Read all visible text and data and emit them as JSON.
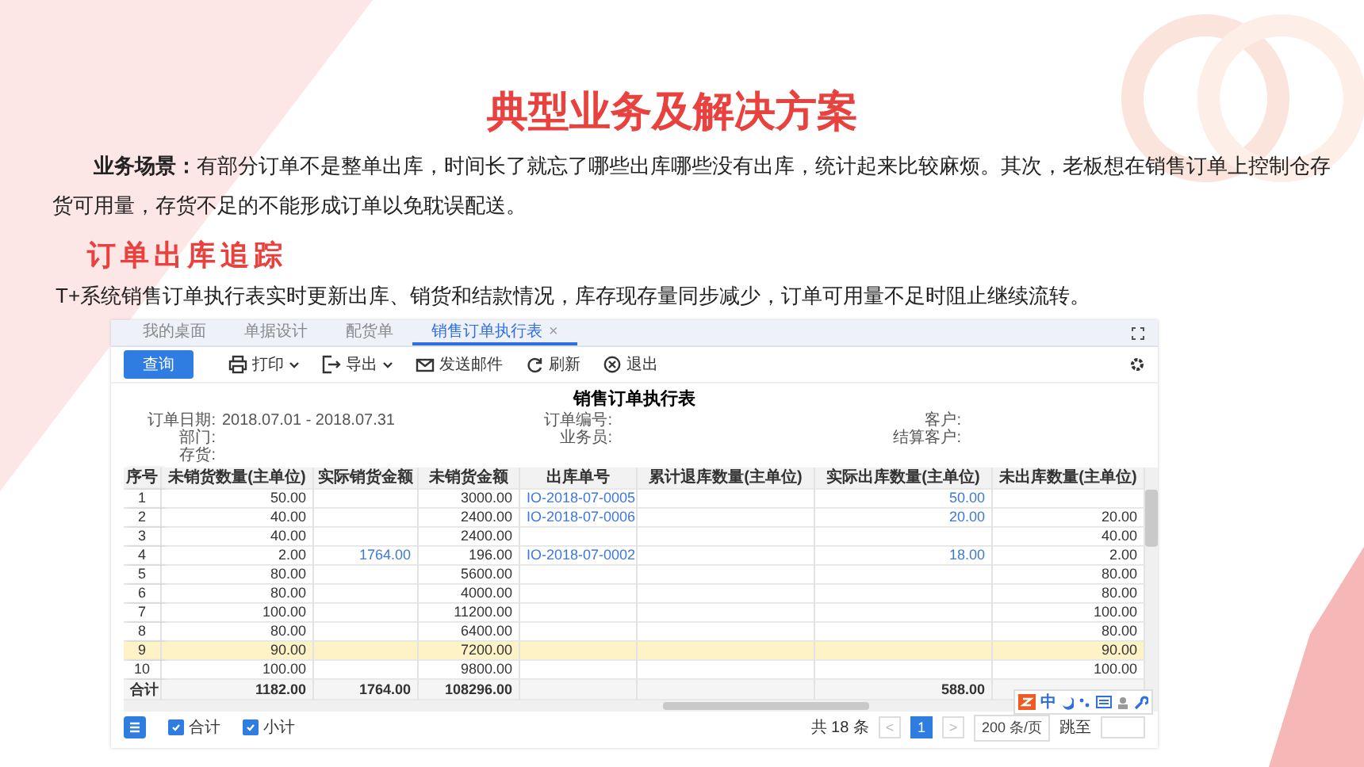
{
  "title": "典型业务及解决方案",
  "scenario": "**业务场景：**有部分订单不是整单出库，时间长了就忘了哪些出库哪些没有出库，统计起来比较麻烦。其次，老板想在销售订单上控制仓存货可用量，存货不足的不能形成订单以免耽误配送。",
  "section_heading": "订单出库追踪",
  "description": "T+系统销售订单执行表实时更新出库、销货和结款情况，库存现存量同步减少，订单可用量不足时阻止继续流转。",
  "app": {
    "tabs": [
      {
        "label": "我的桌面",
        "selected": false
      },
      {
        "label": "单据设计",
        "selected": false
      },
      {
        "label": "配货单",
        "selected": false
      },
      {
        "label": "销售订单执行表",
        "selected": true,
        "close": "×"
      }
    ],
    "toolbar": [
      {
        "label": "查询",
        "kind": "primary"
      },
      {
        "label": "打印",
        "kind": "print",
        "dropdown": true
      },
      {
        "label": "导出",
        "kind": "export",
        "dropdown": true
      },
      {
        "label": "发送邮件",
        "kind": "mail",
        "dropdown": false
      },
      {
        "label": "刷新",
        "kind": "refresh",
        "dropdown": false
      },
      {
        "label": "退出",
        "kind": "exit",
        "dropdown": false
      }
    ],
    "report_title": "销售订单执行表",
    "filters": [
      {
        "label": "订单日期:",
        "value": "2018.07.01 - 2018.07.31"
      },
      {
        "label": "订单编号:"
      },
      {
        "label": "客户:"
      },
      {
        "label": "部门:"
      },
      {
        "label": "业务员:"
      },
      {
        "label": "结算客户:"
      },
      {
        "label": "存货:"
      }
    ],
    "table": {
      "columns": [
        {
          "label": "序号",
          "kind": "index"
        },
        {
          "label": "未销货数量(主单位)",
          "kind": "number"
        },
        {
          "label": "实际销货金额",
          "kind": "linked_number"
        },
        {
          "label": "未销货金额",
          "kind": "number"
        },
        {
          "label": "出库单号",
          "kind": "link"
        },
        {
          "label": "累计退库数量(主单位)",
          "kind": "number"
        },
        {
          "label": "实际出库数量(主单位)",
          "kind": "linked_number"
        },
        {
          "label": "未出库数量(主单位)",
          "kind": "number"
        }
      ],
      "rows": [
        {
          "cells": [
            "1",
            "50.00",
            null,
            "3000.00",
            "IO-2018-07-0005",
            null,
            "50.00",
            null
          ],
          "selected": false
        },
        {
          "cells": [
            "2",
            "40.00",
            null,
            "2400.00",
            "IO-2018-07-0006",
            null,
            "20.00",
            "20.00"
          ],
          "selected": false
        },
        {
          "cells": [
            "3",
            "40.00",
            null,
            "2400.00",
            null,
            null,
            null,
            "40.00"
          ],
          "selected": false
        },
        {
          "cells": [
            "4",
            "2.00",
            "1764.00",
            "196.00",
            "IO-2018-07-0002",
            null,
            "18.00",
            "2.00"
          ],
          "selected": false
        },
        {
          "cells": [
            "5",
            "80.00",
            null,
            "5600.00",
            null,
            null,
            null,
            "80.00"
          ],
          "selected": false
        },
        {
          "cells": [
            "6",
            "80.00",
            null,
            "4000.00",
            null,
            null,
            null,
            "80.00"
          ],
          "selected": false
        },
        {
          "cells": [
            "7",
            "100.00",
            null,
            "11200.00",
            null,
            null,
            null,
            "100.00"
          ],
          "selected": false
        },
        {
          "cells": [
            "8",
            "80.00",
            null,
            "6400.00",
            null,
            null,
            null,
            "80.00"
          ],
          "selected": false
        },
        {
          "cells": [
            "9",
            "90.00",
            null,
            "7200.00",
            null,
            null,
            null,
            "90.00"
          ],
          "selected": true
        },
        {
          "cells": [
            "10",
            "100.00",
            null,
            "9800.00",
            null,
            null,
            null,
            "100.00"
          ],
          "selected": false
        }
      ],
      "totals": {
        "label": "合计",
        "column_2": "1182.00",
        "column_3": "1764.00",
        "column_4": "108296.00",
        "column_7": "588.00"
      }
    },
    "footer": {
      "checkboxes": [
        {
          "label": "合计",
          "checked": true
        },
        {
          "label": "小计",
          "checked": true
        }
      ],
      "count": "共 18 条",
      "prev": "<",
      "pages": [
        {
          "label": "1",
          "selected": true
        }
      ],
      "next": ">",
      "page_size": "200 条/页",
      "jump_label": "跳至"
    },
    "ime_bar": {
      "label": "中"
    }
  }
}
